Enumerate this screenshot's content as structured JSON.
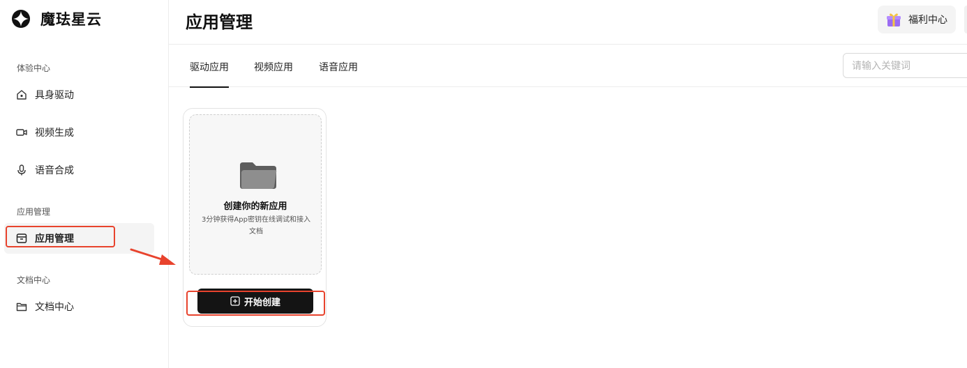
{
  "brand": {
    "name": "魔珐星云"
  },
  "header": {
    "title": "应用管理",
    "welfare_label": "福利中心"
  },
  "sidebar": {
    "groups": [
      {
        "label": "体验中心"
      },
      {
        "label": "应用管理"
      },
      {
        "label": "文档中心"
      }
    ],
    "items": [
      {
        "label": "具身驱动",
        "icon": "home-camera-icon"
      },
      {
        "label": "视频生成",
        "icon": "video-icon"
      },
      {
        "label": "语音合成",
        "icon": "microphone-icon"
      },
      {
        "label": "应用管理",
        "icon": "app-box-icon",
        "active": true
      },
      {
        "label": "文档中心",
        "icon": "folder-outline-icon"
      }
    ]
  },
  "tabs": [
    {
      "label": "驱动应用",
      "active": true
    },
    {
      "label": "视频应用"
    },
    {
      "label": "语音应用"
    }
  ],
  "search": {
    "placeholder": "请输入关键词"
  },
  "card": {
    "title": "创建你的新应用",
    "desc": "3分钟获得App密钥在线调试和接入文档",
    "button_label": "开始创建"
  },
  "colors": {
    "highlight": "#e8432d",
    "button": "#141414"
  }
}
